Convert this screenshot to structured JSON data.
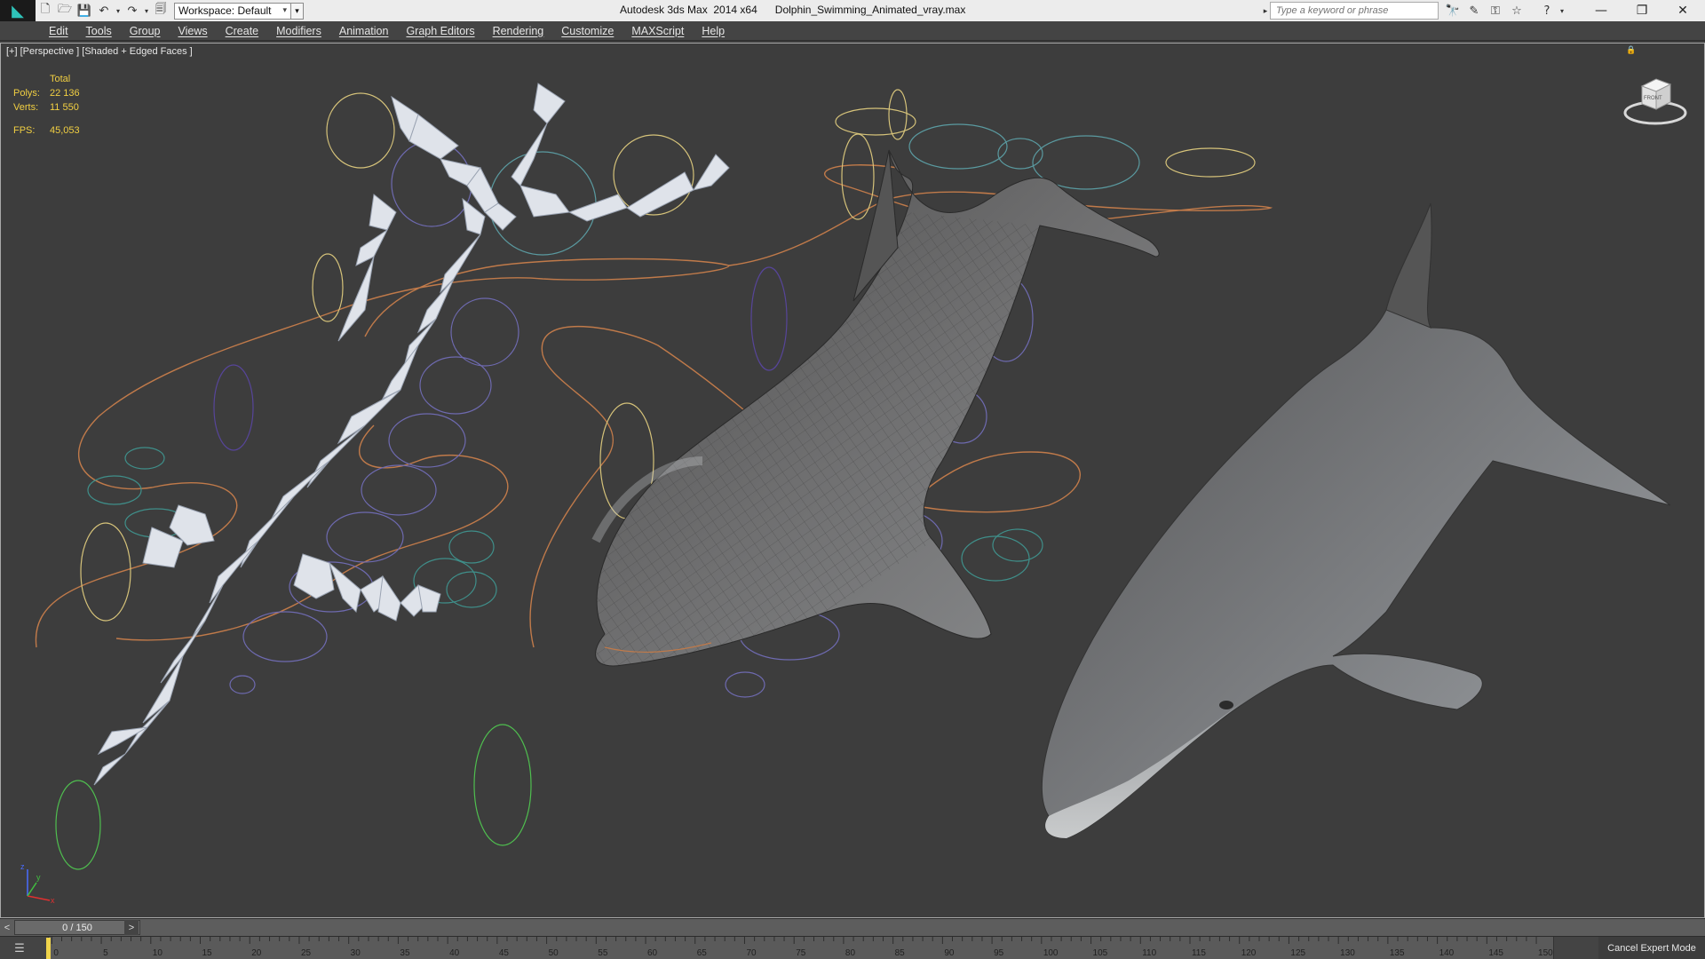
{
  "titlebar": {
    "workspace_label": "Workspace: Default",
    "app_title": "Autodesk 3ds Max  2014 x64",
    "file_name": "Dolphin_Swimming_Animated_vray.max",
    "search_placeholder": "Type a keyword or phrase"
  },
  "menubar": {
    "items": [
      "Edit",
      "Tools",
      "Group",
      "Views",
      "Create",
      "Modifiers",
      "Animation",
      "Graph Editors",
      "Rendering",
      "Customize",
      "MAXScript",
      "Help"
    ]
  },
  "viewport": {
    "label": "[+] [Perspective ] [Shaded + Edged Faces ]",
    "stats": {
      "header": "Total",
      "polys_label": "Polys:",
      "polys_value": "22 136",
      "verts_label": "Verts:",
      "verts_value": "11 550",
      "fps_label": "FPS:",
      "fps_value": "45,053"
    },
    "viewcube_label": "FRONT",
    "axis_labels": {
      "x": "x",
      "y": "y",
      "z": "z"
    }
  },
  "timeline": {
    "slider_label": "0 / 150",
    "current_frame": 0,
    "total_frames": 150,
    "ruler_labels": [
      "0",
      "5",
      "10",
      "15",
      "20",
      "25",
      "30",
      "35",
      "40",
      "45",
      "50",
      "55",
      "60",
      "65",
      "70",
      "75",
      "80",
      "85",
      "90",
      "95",
      "100",
      "105",
      "110",
      "115",
      "120",
      "125",
      "130",
      "135",
      "140",
      "145",
      "150"
    ],
    "cancel_expert_label": "Cancel Expert Mode"
  },
  "colors": {
    "viewport_bg": "#3d3d3d",
    "stats_text": "#f1cf42",
    "spline_orange": "#c07a4a",
    "circle_teal": "#3f8f8a",
    "circle_purple": "#6e6ab0",
    "circle_green": "#4fbf4f",
    "circle_yellow": "#d6c37a"
  }
}
